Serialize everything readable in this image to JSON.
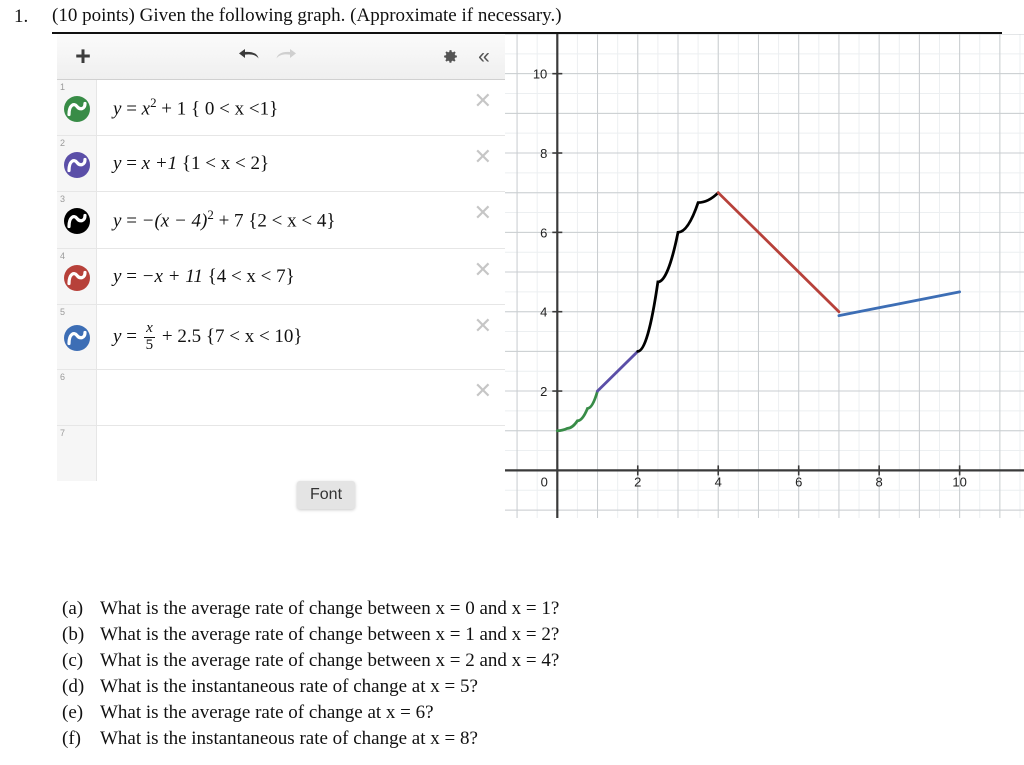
{
  "question": {
    "number": "1.",
    "prompt": "(10 points) Given the following graph. (Approximate if necessary.)"
  },
  "calculator": {
    "toolbar": {
      "add_label": "+",
      "undo_icon": "undo-arrow-icon",
      "redo_icon": "redo-arrow-icon",
      "gear_icon": "gear-icon",
      "collapse_label": "«"
    },
    "delete_label": "✕",
    "font_tooltip": "Font",
    "expressions": [
      {
        "index": "1",
        "color": "#388c47",
        "equation": "y = x² + 1 { 0 < x < 1}",
        "lhs": "y",
        "eq": "=",
        "base": "x",
        "power": "2",
        "rest": "+ 1",
        "domain": "{ 0 < x <1}"
      },
      {
        "index": "2",
        "color": "#5b4fa8",
        "equation": "y = x + 1 {1 < x < 2}",
        "lhs": "y",
        "eq": "=",
        "body": "x +1",
        "domain": "{1 < x < 2}"
      },
      {
        "index": "3",
        "color": "#000000",
        "equation": "y = -(x - 4)² + 7 {2 < x < 4}",
        "lhs": "y",
        "eq": "=",
        "body": "−(x − 4)",
        "power": "2",
        "rest": "+ 7",
        "domain": "{2 < x < 4}"
      },
      {
        "index": "4",
        "color": "#b7413a",
        "equation": "y = -x + 11 {4 < x < 7}",
        "lhs": "y",
        "eq": "=",
        "body": "−x + 11",
        "domain": "{4 < x < 7}"
      },
      {
        "index": "5",
        "color": "#3d6eb5",
        "equation": "y = x/5 + 2.5 {7 < x < 10}",
        "lhs": "y",
        "eq": "=",
        "num": "x",
        "den": "5",
        "rest": "+ 2.5",
        "domain": "{7 < x < 10}"
      },
      {
        "index": "6",
        "color": null,
        "equation": ""
      },
      {
        "index": "7",
        "color": null,
        "equation": ""
      }
    ]
  },
  "chart_data": {
    "type": "line",
    "title": "",
    "xlabel": "",
    "ylabel": "",
    "xlim": [
      -1.3,
      11.6
    ],
    "ylim": [
      -1.2,
      11.0
    ],
    "grid": true,
    "minor_grid_step": 0.5,
    "major_grid_step": 1,
    "x_ticks": [
      0,
      2,
      4,
      6,
      8,
      10
    ],
    "x_tick_labels": [
      "0",
      "2",
      "4",
      "6",
      "8",
      "10"
    ],
    "y_ticks": [
      2,
      4,
      6,
      8,
      10
    ],
    "y_tick_labels": [
      "2",
      "4",
      "6",
      "8",
      "10"
    ],
    "series": [
      {
        "name": "y = x^2 + 1 on (0,1)",
        "color": "#388c47",
        "type": "parabola",
        "domain": [
          0,
          1
        ],
        "points": [
          [
            0,
            1
          ],
          [
            0.25,
            1.06
          ],
          [
            0.5,
            1.25
          ],
          [
            0.75,
            1.56
          ],
          [
            1,
            2
          ]
        ]
      },
      {
        "name": "y = x + 1 on (1,2)",
        "color": "#5b4fa8",
        "type": "segment",
        "domain": [
          1,
          2
        ],
        "points": [
          [
            1,
            2
          ],
          [
            2,
            3
          ]
        ]
      },
      {
        "name": "y = -(x-4)^2 + 7 on (2,4)",
        "color": "#000000",
        "type": "parabola",
        "domain": [
          2,
          4
        ],
        "points": [
          [
            2,
            3
          ],
          [
            2.5,
            4.75
          ],
          [
            3,
            6
          ],
          [
            3.5,
            6.75
          ],
          [
            4,
            7
          ]
        ]
      },
      {
        "name": "y = -x + 11 on (4,7)",
        "color": "#b7413a",
        "type": "segment",
        "domain": [
          4,
          7
        ],
        "points": [
          [
            4,
            7
          ],
          [
            7,
            4
          ]
        ]
      },
      {
        "name": "y = x/5 + 2.5 on (7,10)",
        "color": "#3d6eb5",
        "type": "segment",
        "domain": [
          7,
          10
        ],
        "points": [
          [
            7,
            3.9
          ],
          [
            10,
            4.5
          ]
        ]
      }
    ]
  },
  "subquestions": [
    {
      "label": "(a)",
      "text": "What is the average rate of change between x = 0 and x = 1?"
    },
    {
      "label": "(b)",
      "text": "What is the average rate of change between x = 1 and x = 2?"
    },
    {
      "label": "(c)",
      "text": "What is the average rate of change between x = 2 and x = 4?"
    },
    {
      "label": "(d)",
      "text": "What is the instantaneous rate of change at x = 5?"
    },
    {
      "label": "(e)",
      "text": "What is the average rate of change at x = 6?"
    },
    {
      "label": "(f)",
      "text": "What is the instantaneous rate of change at x = 8?"
    }
  ]
}
